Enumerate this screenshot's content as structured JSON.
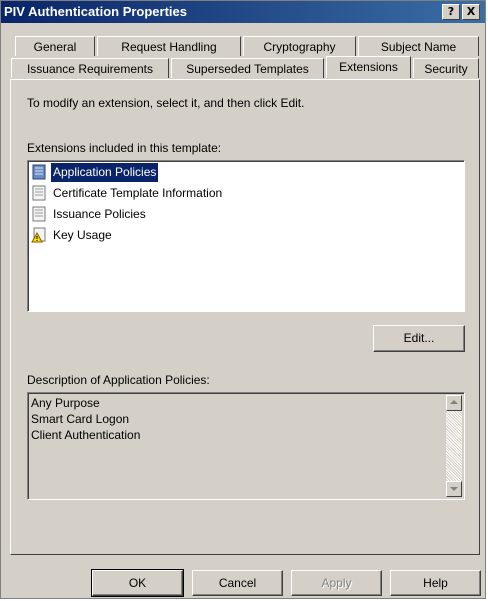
{
  "window": {
    "title": "PIV Authentication Properties",
    "help_glyph": "?",
    "close_glyph": "X"
  },
  "tabs": {
    "row_back": [
      {
        "label": "General"
      },
      {
        "label": "Request Handling"
      },
      {
        "label": "Cryptography"
      },
      {
        "label": "Subject Name"
      }
    ],
    "row_front": [
      {
        "label": "Issuance Requirements"
      },
      {
        "label": "Superseded Templates"
      },
      {
        "label": "Extensions",
        "active": true
      },
      {
        "label": "Security"
      }
    ]
  },
  "panel": {
    "instruction": "To modify an extension, select it, and then click Edit.",
    "extensions_label": "Extensions included in this template:",
    "extensions": [
      {
        "label": "Application Policies",
        "icon": "certificate-extension-icon",
        "selected": true
      },
      {
        "label": "Certificate Template Information",
        "icon": "certificate-extension-icon"
      },
      {
        "label": "Issuance Policies",
        "icon": "certificate-extension-icon"
      },
      {
        "label": "Key Usage",
        "icon": "warning-extension-icon"
      }
    ],
    "edit_button": "Edit...",
    "description_label": "Description of Application Policies:",
    "description_lines": [
      "Any Purpose",
      "Smart Card Logon",
      "Client Authentication"
    ]
  },
  "buttons": {
    "ok": "OK",
    "cancel": "Cancel",
    "apply": "Apply",
    "help": "Help"
  },
  "colors": {
    "titlebar": "#0a246a",
    "face": "#d4d0c8",
    "selection": "#0a246a"
  }
}
